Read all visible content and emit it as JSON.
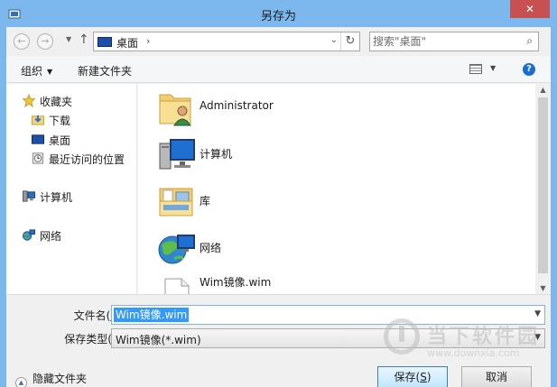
{
  "window": {
    "title": "另存为",
    "close_glyph": "✕"
  },
  "address_bar": {
    "back_glyph": "←",
    "forward_glyph": "→",
    "up_glyph": "↑",
    "breadcrumb": "桌面",
    "breadcrumb_sep": "›",
    "dropdown_glyph": "⌄",
    "refresh_glyph": "↻",
    "search_placeholder": "搜索\"桌面\"",
    "search_glyph": "⌕"
  },
  "toolbar": {
    "organize_label": "组织",
    "new_folder_label": "新建文件夹",
    "help_glyph": "?"
  },
  "nav_pane": {
    "favorites": "收藏夹",
    "downloads": "下载",
    "desktop": "桌面",
    "recent": "最近访问的位置",
    "computer": "计算机",
    "network": "网络"
  },
  "files": [
    {
      "name": "Administrator",
      "icon": "user-folder-icon"
    },
    {
      "name": "计算机",
      "icon": "computer-icon"
    },
    {
      "name": "库",
      "icon": "library-icon"
    },
    {
      "name": "网络",
      "icon": "network-icon"
    },
    {
      "name": "Wim镜像.wim",
      "icon": "file-icon"
    }
  ],
  "form": {
    "filename_label_pre": "文件名(",
    "filename_label_key": "N",
    "filename_label_post": "):",
    "filename_value": "Wim镜像.wim",
    "filetype_label_pre": "保存类型(",
    "filetype_label_key": "T",
    "filetype_label_post": "):",
    "filetype_value": "Wim镜像(*.wim)",
    "hide_folders_label": "隐藏文件夹",
    "save_label_pre": "保存(",
    "save_label_key": "S",
    "save_label_post": ")",
    "cancel_label": "取消"
  },
  "watermark": {
    "brand": "当下软件园",
    "url": "www.downxia.com"
  },
  "colors": {
    "title_bar": "#7cb8ee",
    "close_button": "#c75050",
    "selection": "#3399ff"
  }
}
